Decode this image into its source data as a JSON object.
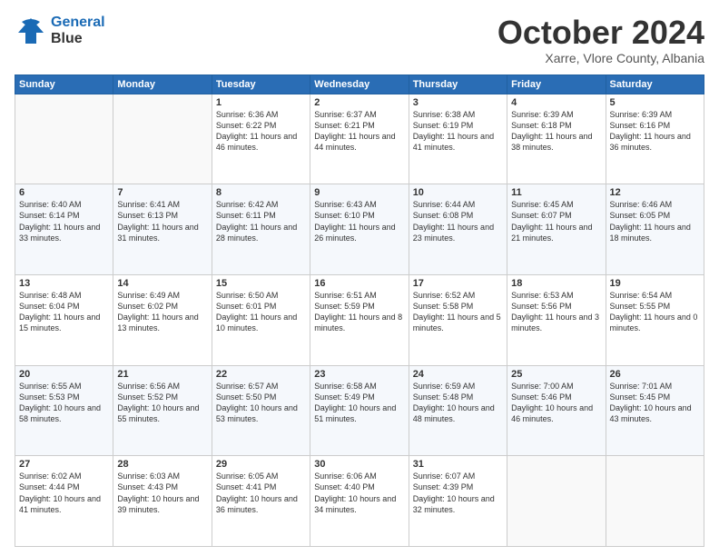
{
  "header": {
    "logo_line1": "General",
    "logo_line2": "Blue",
    "month": "October 2024",
    "location": "Xarre, Vlore County, Albania"
  },
  "days": [
    "Sunday",
    "Monday",
    "Tuesday",
    "Wednesday",
    "Thursday",
    "Friday",
    "Saturday"
  ],
  "weeks": [
    [
      {
        "num": "",
        "info": ""
      },
      {
        "num": "",
        "info": ""
      },
      {
        "num": "1",
        "info": "Sunrise: 6:36 AM\nSunset: 6:22 PM\nDaylight: 11 hours and 46 minutes."
      },
      {
        "num": "2",
        "info": "Sunrise: 6:37 AM\nSunset: 6:21 PM\nDaylight: 11 hours and 44 minutes."
      },
      {
        "num": "3",
        "info": "Sunrise: 6:38 AM\nSunset: 6:19 PM\nDaylight: 11 hours and 41 minutes."
      },
      {
        "num": "4",
        "info": "Sunrise: 6:39 AM\nSunset: 6:18 PM\nDaylight: 11 hours and 38 minutes."
      },
      {
        "num": "5",
        "info": "Sunrise: 6:39 AM\nSunset: 6:16 PM\nDaylight: 11 hours and 36 minutes."
      }
    ],
    [
      {
        "num": "6",
        "info": "Sunrise: 6:40 AM\nSunset: 6:14 PM\nDaylight: 11 hours and 33 minutes."
      },
      {
        "num": "7",
        "info": "Sunrise: 6:41 AM\nSunset: 6:13 PM\nDaylight: 11 hours and 31 minutes."
      },
      {
        "num": "8",
        "info": "Sunrise: 6:42 AM\nSunset: 6:11 PM\nDaylight: 11 hours and 28 minutes."
      },
      {
        "num": "9",
        "info": "Sunrise: 6:43 AM\nSunset: 6:10 PM\nDaylight: 11 hours and 26 minutes."
      },
      {
        "num": "10",
        "info": "Sunrise: 6:44 AM\nSunset: 6:08 PM\nDaylight: 11 hours and 23 minutes."
      },
      {
        "num": "11",
        "info": "Sunrise: 6:45 AM\nSunset: 6:07 PM\nDaylight: 11 hours and 21 minutes."
      },
      {
        "num": "12",
        "info": "Sunrise: 6:46 AM\nSunset: 6:05 PM\nDaylight: 11 hours and 18 minutes."
      }
    ],
    [
      {
        "num": "13",
        "info": "Sunrise: 6:48 AM\nSunset: 6:04 PM\nDaylight: 11 hours and 15 minutes."
      },
      {
        "num": "14",
        "info": "Sunrise: 6:49 AM\nSunset: 6:02 PM\nDaylight: 11 hours and 13 minutes."
      },
      {
        "num": "15",
        "info": "Sunrise: 6:50 AM\nSunset: 6:01 PM\nDaylight: 11 hours and 10 minutes."
      },
      {
        "num": "16",
        "info": "Sunrise: 6:51 AM\nSunset: 5:59 PM\nDaylight: 11 hours and 8 minutes."
      },
      {
        "num": "17",
        "info": "Sunrise: 6:52 AM\nSunset: 5:58 PM\nDaylight: 11 hours and 5 minutes."
      },
      {
        "num": "18",
        "info": "Sunrise: 6:53 AM\nSunset: 5:56 PM\nDaylight: 11 hours and 3 minutes."
      },
      {
        "num": "19",
        "info": "Sunrise: 6:54 AM\nSunset: 5:55 PM\nDaylight: 11 hours and 0 minutes."
      }
    ],
    [
      {
        "num": "20",
        "info": "Sunrise: 6:55 AM\nSunset: 5:53 PM\nDaylight: 10 hours and 58 minutes."
      },
      {
        "num": "21",
        "info": "Sunrise: 6:56 AM\nSunset: 5:52 PM\nDaylight: 10 hours and 55 minutes."
      },
      {
        "num": "22",
        "info": "Sunrise: 6:57 AM\nSunset: 5:50 PM\nDaylight: 10 hours and 53 minutes."
      },
      {
        "num": "23",
        "info": "Sunrise: 6:58 AM\nSunset: 5:49 PM\nDaylight: 10 hours and 51 minutes."
      },
      {
        "num": "24",
        "info": "Sunrise: 6:59 AM\nSunset: 5:48 PM\nDaylight: 10 hours and 48 minutes."
      },
      {
        "num": "25",
        "info": "Sunrise: 7:00 AM\nSunset: 5:46 PM\nDaylight: 10 hours and 46 minutes."
      },
      {
        "num": "26",
        "info": "Sunrise: 7:01 AM\nSunset: 5:45 PM\nDaylight: 10 hours and 43 minutes."
      }
    ],
    [
      {
        "num": "27",
        "info": "Sunrise: 6:02 AM\nSunset: 4:44 PM\nDaylight: 10 hours and 41 minutes."
      },
      {
        "num": "28",
        "info": "Sunrise: 6:03 AM\nSunset: 4:43 PM\nDaylight: 10 hours and 39 minutes."
      },
      {
        "num": "29",
        "info": "Sunrise: 6:05 AM\nSunset: 4:41 PM\nDaylight: 10 hours and 36 minutes."
      },
      {
        "num": "30",
        "info": "Sunrise: 6:06 AM\nSunset: 4:40 PM\nDaylight: 10 hours and 34 minutes."
      },
      {
        "num": "31",
        "info": "Sunrise: 6:07 AM\nSunset: 4:39 PM\nDaylight: 10 hours and 32 minutes."
      },
      {
        "num": "",
        "info": ""
      },
      {
        "num": "",
        "info": ""
      }
    ]
  ]
}
